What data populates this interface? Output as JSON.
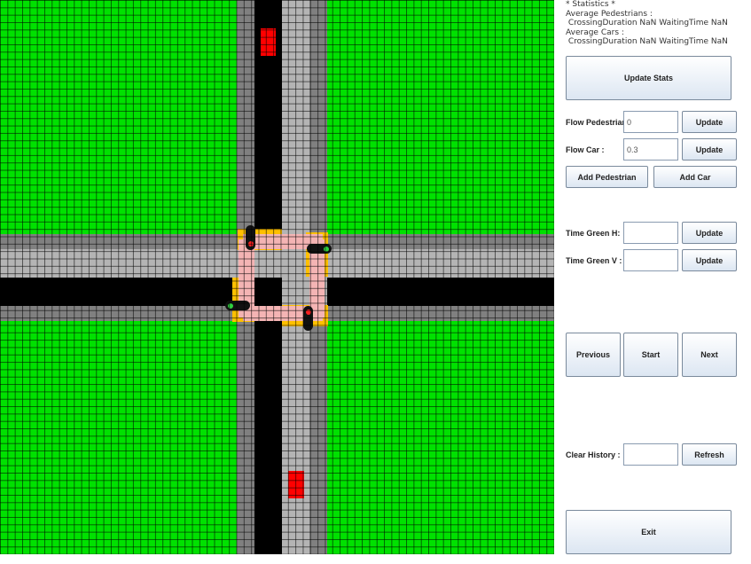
{
  "stats": {
    "heading": "* Statistics *",
    "ped_title": "Average Pedestrians :",
    "ped_values": " CrossingDuration NaN WaitingTime NaN",
    "car_title": "Average Cars :",
    "car_values": " CrossingDuration NaN WaitingTime NaN"
  },
  "buttons": {
    "update_stats": "Update Stats",
    "update_flow_ped": "Update",
    "update_flow_car": "Update",
    "add_pedestrian": "Add Pedestrian",
    "add_car": "Add Car",
    "update_green_h": "Update",
    "update_green_v": "Update",
    "previous": "Previous",
    "start": "Start",
    "next": "Next",
    "refresh": "Refresh",
    "exit": "Exit"
  },
  "labels": {
    "flow_pedestrian": "Flow Pedestrian :",
    "flow_car": "Flow Car :",
    "time_green_h": "Time Green H:",
    "time_green_v": "Time Green V :",
    "clear_history": "Clear History :"
  },
  "inputs": {
    "flow_pedestrian": "0",
    "flow_car": "0.3",
    "time_green_h": "",
    "time_green_v": "",
    "clear_history": ""
  },
  "colors": {
    "grass": "#00e100",
    "road_dark": "#000000",
    "road_light": "#b4b4b4",
    "sidewalk": "#808080",
    "crosswalk": "#f4b4b4",
    "traffic_light_frame": "#ffc000",
    "car": "#ff0000",
    "light_red": "#ff2020",
    "light_green": "#30d040"
  },
  "traffic_lights": [
    {
      "name": "nw",
      "state": "red"
    },
    {
      "name": "ne",
      "state": "green"
    },
    {
      "name": "sw",
      "state": "green"
    },
    {
      "name": "se",
      "state": "red"
    }
  ]
}
